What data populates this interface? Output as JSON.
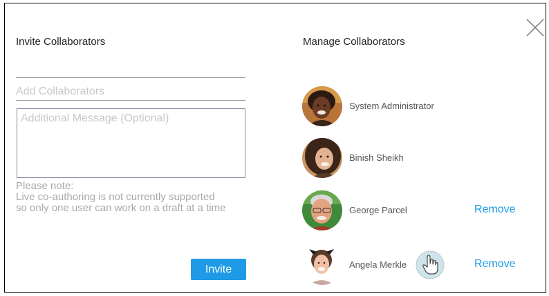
{
  "invite": {
    "title": "Invite Collaborators",
    "first_field_value": "",
    "add_placeholder": "Add Collaborators",
    "message_placeholder": "Additional Message (Optional)",
    "note_lines": [
      "Please note:",
      "Live co-authoring is not currently supported",
      "so only one user can work on a draft at a time"
    ],
    "invite_label": "Invite"
  },
  "manage": {
    "title": "Manage Collaborators",
    "collaborators": [
      {
        "name": "System Administrator",
        "remove_label": ""
      },
      {
        "name": "Binish Sheikh",
        "remove_label": ""
      },
      {
        "name": "George Parcel",
        "remove_label": "Remove"
      },
      {
        "name": "Angela Merkle",
        "remove_label": "Remove"
      }
    ]
  },
  "icons": {
    "close": "close-icon",
    "cursor": "hand-pointer-icon"
  },
  "colors": {
    "accent": "#1e9ae6",
    "note_text": "#a9a9a9",
    "placeholder": "#c8c8c8"
  }
}
